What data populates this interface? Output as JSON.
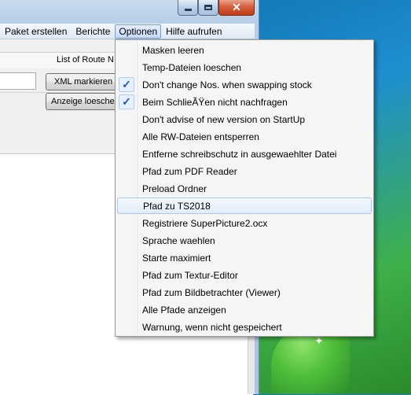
{
  "menubar": {
    "items": [
      "Paket erstellen",
      "Berichte",
      "Optionen",
      "Hilfe aufrufen"
    ]
  },
  "window": {
    "route_label": "List of Route N",
    "xml_button": "XML markieren",
    "clear_button": "Anzeige loeschen",
    "close_glyph": "✕"
  },
  "dropdown": {
    "check_glyph": "✓",
    "items": [
      {
        "label": "Masken leeren",
        "checked": false
      },
      {
        "label": "Temp-Dateien loeschen",
        "checked": false
      },
      {
        "label": "Don't change Nos. when swapping stock",
        "checked": true
      },
      {
        "label": "Beim SchlieÃŸen nicht nachfragen",
        "checked": true
      },
      {
        "label": "Don't advise of new version on StartUp",
        "checked": false
      },
      {
        "label": "Alle RW-Dateien entsperren",
        "checked": false
      },
      {
        "label": "Entferne schreibschutz in ausgewaehlter Datei",
        "checked": false
      },
      {
        "label": "Pfad zum PDF Reader",
        "checked": false
      },
      {
        "label": "Preload Ordner",
        "checked": false
      },
      {
        "label": "Pfad zu TS2018",
        "checked": false,
        "highlighted": true
      },
      {
        "label": "Registriere SuperPicture2.ocx",
        "checked": false
      },
      {
        "label": "Sprache waehlen",
        "checked": false
      },
      {
        "label": "Starte maximiert",
        "checked": false
      },
      {
        "label": "Pfad zum Textur-Editor",
        "checked": false
      },
      {
        "label": "Pfad zum Bildbetrachter (Viewer)",
        "checked": false
      },
      {
        "label": "Alle Pfade anzeigen",
        "checked": false
      },
      {
        "label": "Warnung, wenn nicht gespeichert",
        "checked": false
      }
    ]
  },
  "colors": {
    "accent_check": "#1d56c5",
    "highlight_border": "#a8c8ee"
  }
}
